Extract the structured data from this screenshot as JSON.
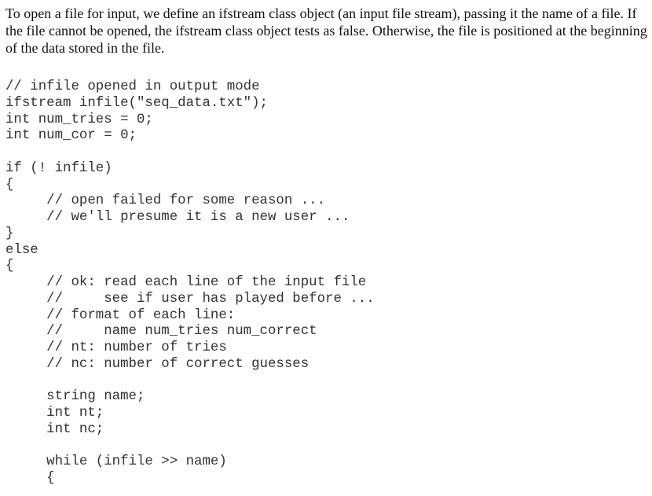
{
  "document": {
    "intro_text": "To open a file for input, we define an ifstream class object (an input file stream), passing it the name of a file. If the file cannot be opened, the ifstream class object tests as false. Otherwise, the file is positioned at the beginning of the data stored in the file.",
    "code_lines": [
      "// infile opened in output mode",
      "ifstream infile(\"seq_data.txt\");",
      "int num_tries = 0;",
      "int num_cor = 0;",
      "",
      "if (! infile)",
      "{",
      "     // open failed for some reason ...",
      "     // we'll presume it is a new user ...",
      "}",
      "else",
      "{",
      "     // ok: read each line of the input file",
      "     //     see if user has played before ...",
      "     // format of each line:",
      "     //     name num_tries num_correct",
      "     // nt: number of tries",
      "     // nc: number of correct guesses",
      "",
      "     string name;",
      "     int nt;",
      "     int nc;",
      "",
      "     while (infile >> name)",
      "     {"
    ]
  }
}
